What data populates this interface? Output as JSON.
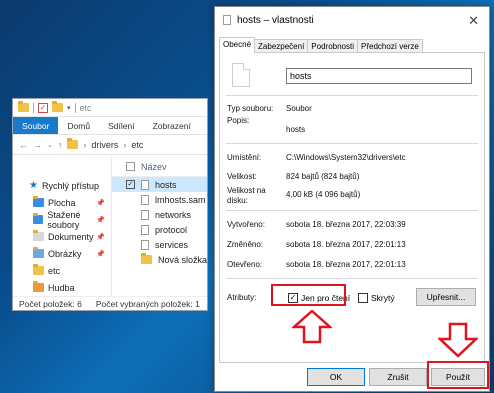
{
  "explorer": {
    "title": "etc",
    "ribbon_tabs": [
      "Soubor",
      "Domů",
      "Sdílení",
      "Zobrazení"
    ],
    "address": [
      "drivers",
      "etc"
    ],
    "nav": [
      {
        "label": "Rychlý přístup",
        "icon": "star-icon"
      },
      {
        "label": "Plocha",
        "icon": "desktop-folder-icon"
      },
      {
        "label": "Stažené soubory",
        "icon": "downloads-folder-icon"
      },
      {
        "label": "Dokumenty",
        "icon": "documents-folder-icon"
      },
      {
        "label": "Obrázky",
        "icon": "pictures-folder-icon"
      },
      {
        "label": "etc",
        "icon": "folder-icon"
      },
      {
        "label": "Hudba",
        "icon": "music-folder-icon"
      }
    ],
    "column_header": "Název",
    "files": [
      "hosts",
      "lmhosts.sam",
      "networks",
      "protocol",
      "services",
      "Nová složka"
    ],
    "status_count": "Počet položek: 6",
    "status_selected": "Počet vybraných položek: 1"
  },
  "dialog": {
    "title": "hosts – vlastnosti",
    "tabs": [
      "Obecné",
      "Zabezpečení",
      "Podrobnosti",
      "Předchozí verze"
    ],
    "filename": "hosts",
    "type_label": "Typ souboru:",
    "type_value": "Soubor",
    "desc_label": "Popis:",
    "desc_value": "hosts",
    "location_label": "Umístění:",
    "location_value": "C:\\Windows\\System32\\drivers\\etc",
    "size_label": "Velikost:",
    "size_value": "824 bajtů (824 bajtů)",
    "disk_label": "Velikost na disku:",
    "disk_value": "4,00 kB (4 096 bajtů)",
    "created_label": "Vytvořeno:",
    "created_value": "sobota 18. března 2017, 22:03:39",
    "modified_label": "Změněno:",
    "modified_value": "sobota 18. března 2017, 22:01:13",
    "opened_label": "Otevřeno:",
    "opened_value": "sobota 18. března 2017, 22:01:13",
    "attrs_label": "Atributy:",
    "readonly_label": "Jen pro čtení",
    "hidden_label": "Skrytý",
    "advanced_button": "Upřesnit...",
    "ok_button": "OK",
    "cancel_button": "Zrušit",
    "apply_button": "Použít"
  },
  "annotations": {
    "highlight_color": "#e0141e"
  }
}
